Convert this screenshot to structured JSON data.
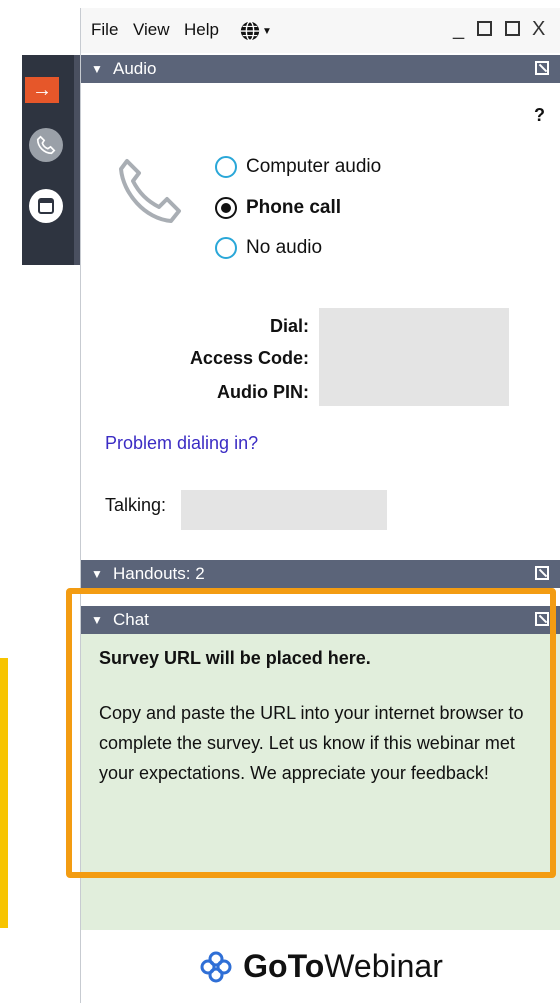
{
  "menu": {
    "file": "File",
    "view": "View",
    "help": "Help"
  },
  "window_controls": {
    "minimize": "_",
    "close": "X"
  },
  "audio": {
    "header": "Audio",
    "help": "?",
    "options": [
      {
        "label": "Computer audio",
        "selected": false
      },
      {
        "label": "Phone call",
        "selected": true
      },
      {
        "label": "No audio",
        "selected": false
      }
    ],
    "dial_label": "Dial:",
    "access_code_label": "Access Code:",
    "audio_pin_label": "Audio PIN:",
    "problem_link": "Problem dialing in?",
    "talking_label": "Talking:"
  },
  "handouts": {
    "header": "Handouts: 2"
  },
  "chat": {
    "header": "Chat",
    "title": "Survey URL will be placed here.",
    "message": "Copy and paste the URL into your internet browser to complete the survey. Let us know if this webinar met your expectations. We appreciate your feedback!"
  },
  "brand": {
    "goto": "GoTo",
    "webinar": "Webinar"
  },
  "colors": {
    "header_bg": "#5b6479",
    "chat_bg": "#e1eedc",
    "highlight": "#f39c12",
    "link": "#3b2cc4",
    "radio_ring": "#2aa7d8",
    "strip_accent": "#e6572a"
  },
  "icons": {
    "strip": [
      "arrow-right-icon",
      "phone-icon",
      "window-icon"
    ],
    "menu": [
      "globe-icon"
    ],
    "headers": [
      "collapse-triangle-icon",
      "popout-icon"
    ]
  }
}
